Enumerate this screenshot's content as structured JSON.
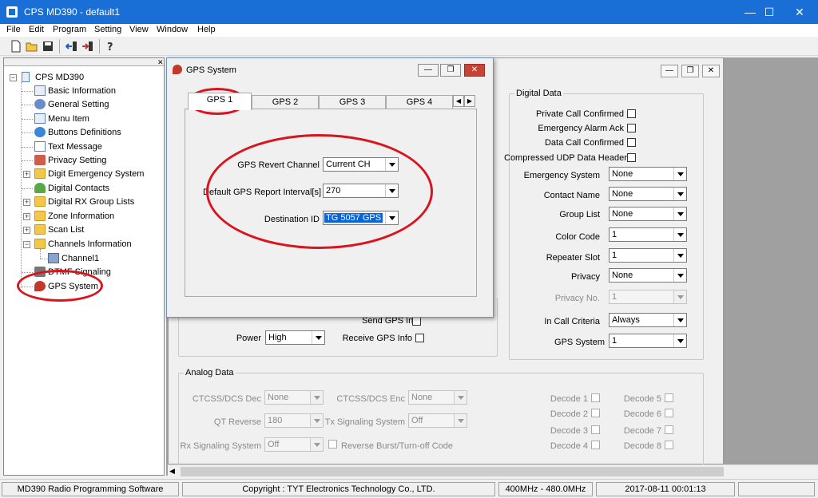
{
  "window": {
    "title": "CPS MD390 - default1",
    "minimize": "—",
    "maximize": "☐",
    "close": "✕"
  },
  "menu": [
    "File",
    "Edit",
    "Program",
    "Setting",
    "View",
    "Window",
    "Help"
  ],
  "tree": {
    "root": "CPS MD390",
    "items": [
      "Basic Information",
      "General Setting",
      "Menu Item",
      "Buttons Definitions",
      "Text Message",
      "Privacy Setting",
      "Digit Emergency System",
      "Digital Contacts",
      "Digital RX Group Lists",
      "Zone Information",
      "Scan List",
      "Channels Information",
      "Channel1",
      "DTMF Signaling",
      "GPS System"
    ]
  },
  "gps_dialog": {
    "title": "GPS System",
    "tabs": [
      "GPS 1",
      "GPS 2",
      "GPS 3",
      "GPS 4"
    ],
    "fields": {
      "revert_channel_label": "GPS Revert Channel",
      "revert_channel_value": "Current CH",
      "report_interval_label": "Default GPS Report Interval[s]",
      "report_interval_value": "270",
      "destination_label": "Destination ID",
      "destination_value": "TG 5057 GPS"
    }
  },
  "channel": {
    "send_gps_info": "Send GPS Info",
    "power_label": "Power",
    "power_value": "High",
    "receive_gps_info": "Receive GPS Info",
    "digital_data": {
      "title": "Digital Data",
      "private_call_confirmed": "Private Call Confirmed",
      "emergency_alarm_ack": "Emergency Alarm Ack",
      "data_call_confirmed": "Data Call Confirmed",
      "compressed_udp": "Compressed UDP Data Header",
      "emergency_system_label": "Emergency System",
      "emergency_system_value": "None",
      "contact_name_label": "Contact Name",
      "contact_name_value": "None",
      "group_list_label": "Group List",
      "group_list_value": "None",
      "color_code_label": "Color Code",
      "color_code_value": "1",
      "repeater_slot_label": "Repeater Slot",
      "repeater_slot_value": "1",
      "privacy_label": "Privacy",
      "privacy_value": "None",
      "privacy_no_label": "Privacy No.",
      "privacy_no_value": "1",
      "in_call_criteria_label": "In Call Criteria",
      "in_call_criteria_value": "Always",
      "gps_system_label": "GPS System",
      "gps_system_value": "1"
    },
    "analog_data": {
      "title": "Analog Data",
      "ctcss_dec_label": "CTCSS/DCS Dec",
      "ctcss_dec_value": "None",
      "ctcss_enc_label": "CTCSS/DCS Enc",
      "ctcss_enc_value": "None",
      "qt_reverse_label": "QT Reverse",
      "qt_reverse_value": "180",
      "tx_signaling_label": "Tx Signaling System",
      "tx_signaling_value": "Off",
      "rx_signaling_label": "Rx Signaling System",
      "rx_signaling_value": "Off",
      "reverse_burst": "Reverse Burst/Turn-off Code",
      "decode": [
        "Decode 1",
        "Decode 2",
        "Decode 3",
        "Decode 4",
        "Decode 5",
        "Decode 6",
        "Decode 7",
        "Decode 8"
      ]
    }
  },
  "status": {
    "app": "MD390 Radio Programming Software",
    "copyright": "Copyright : TYT Electronics Technology Co., LTD.",
    "band": "400MHz - 480.0MHz",
    "datetime": "2017-08-11 00:01:13"
  },
  "colors": {
    "titlebar": "#1a6fd6",
    "highlight": "#d9141e",
    "selection": "#0a64d8"
  }
}
